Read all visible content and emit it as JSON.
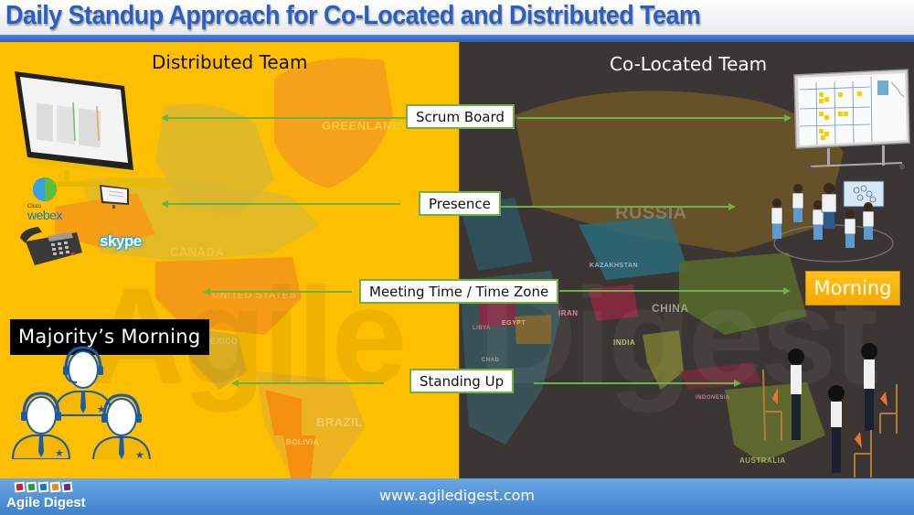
{
  "header": {
    "title": "Daily Standup Approach for Co-Located and Distributed Team"
  },
  "left_panel": {
    "heading": "Distributed Team",
    "map_labels": [
      "GREENLAND",
      "CANADA",
      "UNITED STATES",
      "MEXICO",
      "BRAZIL",
      "BOLIVIA"
    ],
    "watermark": "Agile",
    "tools": [
      "Cisco webex",
      "skype"
    ],
    "webex_brand": {
      "top": "Cisco",
      "main": "webex"
    },
    "skype_label": "skype",
    "meeting_time": "Majority’s  Morning"
  },
  "right_panel": {
    "heading": "Co-Located Team",
    "map_labels": [
      "RUSSIA",
      "KAZAKHSTAN",
      "CHINA",
      "IRAN",
      "INDIA",
      "EGYPT",
      "LIBYA",
      "CHAD",
      "AUSTRALIA",
      "INDONESIA"
    ],
    "watermark": "Digest",
    "meeting_time": "Morning"
  },
  "aspects": [
    {
      "label": "Scrum Board"
    },
    {
      "label": "Presence"
    },
    {
      "label": "Meeting Time  / Time Zone"
    },
    {
      "label": "Standing Up"
    }
  ],
  "colors": {
    "distributed_bg": "#fdbf00",
    "colocated_bg": "#3b3634",
    "arrow": "#69b544",
    "title": "#2a5fc0",
    "footer": "#4f8fd6"
  },
  "footer": {
    "logo_text": "Agile Digest",
    "logo_colors": [
      "#c0262d",
      "#2e9a3a",
      "#1f73c2",
      "#f08a1c",
      "#6b2b8c"
    ],
    "url": "www.agiledigest.com"
  }
}
